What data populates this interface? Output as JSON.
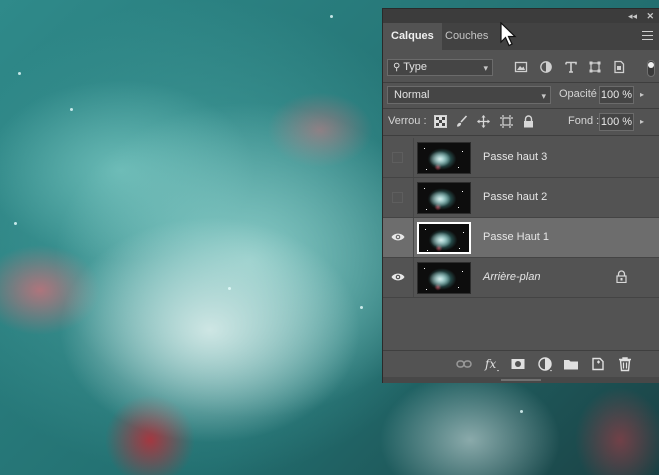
{
  "panel": {
    "tabs": [
      {
        "label": "Calques",
        "active": true
      },
      {
        "label": "Couches",
        "active": false
      }
    ],
    "collapse_icon": "double-chevron-left-icon",
    "close_icon": "close-icon",
    "menu_icon": "hamburger-menu-icon"
  },
  "filter": {
    "kind_label": "Type",
    "icons": [
      "image-filter-icon",
      "adjustment-filter-icon",
      "text-filter-icon",
      "shape-filter-icon",
      "smart-object-filter-icon"
    ]
  },
  "blend": {
    "mode": "Normal",
    "opacity_label": "Opacité :",
    "opacity_value": "100 %"
  },
  "lock": {
    "label": "Verrou :",
    "icons": [
      "lock-transparency-icon",
      "lock-paint-icon",
      "lock-position-icon",
      "lock-artboard-icon",
      "lock-all-icon"
    ],
    "fill_label": "Fond :",
    "fill_value": "100 %"
  },
  "layers": [
    {
      "name": "Passe haut 3",
      "visible": false,
      "selected": false,
      "italic": false,
      "locked": false
    },
    {
      "name": "Passe haut 2",
      "visible": false,
      "selected": false,
      "italic": false,
      "locked": false
    },
    {
      "name": "Passe Haut 1",
      "visible": true,
      "selected": true,
      "italic": false,
      "locked": false
    },
    {
      "name": "Arrière-plan",
      "visible": true,
      "selected": false,
      "italic": true,
      "locked": true
    }
  ],
  "bottom_icons": [
    "link-layers-icon",
    "fx-icon",
    "layer-mask-icon",
    "adjustment-layer-icon",
    "new-group-icon",
    "new-layer-icon",
    "trash-icon"
  ],
  "colors": {
    "panel_bg": "#535353",
    "selected_layer": "#6d6d6d",
    "tab_bar": "#424242"
  }
}
